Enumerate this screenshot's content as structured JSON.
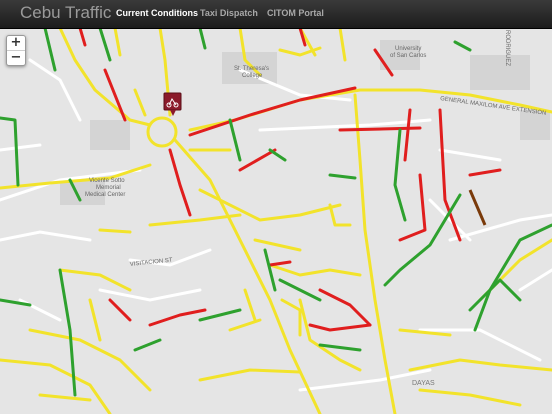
{
  "app": {
    "brand": "Cebu Traffic"
  },
  "nav": {
    "items": [
      {
        "label": "Current Conditions",
        "active": true
      },
      {
        "label": "Taxi Dispatch",
        "active": false
      },
      {
        "label": "CITOM Portal",
        "active": false
      }
    ]
  },
  "map": {
    "zoom_in": "+",
    "zoom_out": "−",
    "labels": {
      "st_theresas": "St. Theresa's",
      "college": "College",
      "university": "University",
      "of_san_carlos": "of San Carlos",
      "vicente_sotto": "Vicente Sotto",
      "memorial": "Memorial",
      "medical_center": "Medical Center",
      "visitacion": "VISITACION ST",
      "general_maxilom": "GENERAL MAXILOM AVE EXTENSION",
      "days": "DAYAS",
      "rodriguez": "RODRIGUEZ"
    },
    "marker_icon": "incident-marker-icon",
    "legend_colors": {
      "free_flow": "#2ea12e",
      "moderate": "#f2e32b",
      "heavy": "#e01e1e",
      "road": "#ffffff",
      "land": "#e5e5e5"
    }
  }
}
